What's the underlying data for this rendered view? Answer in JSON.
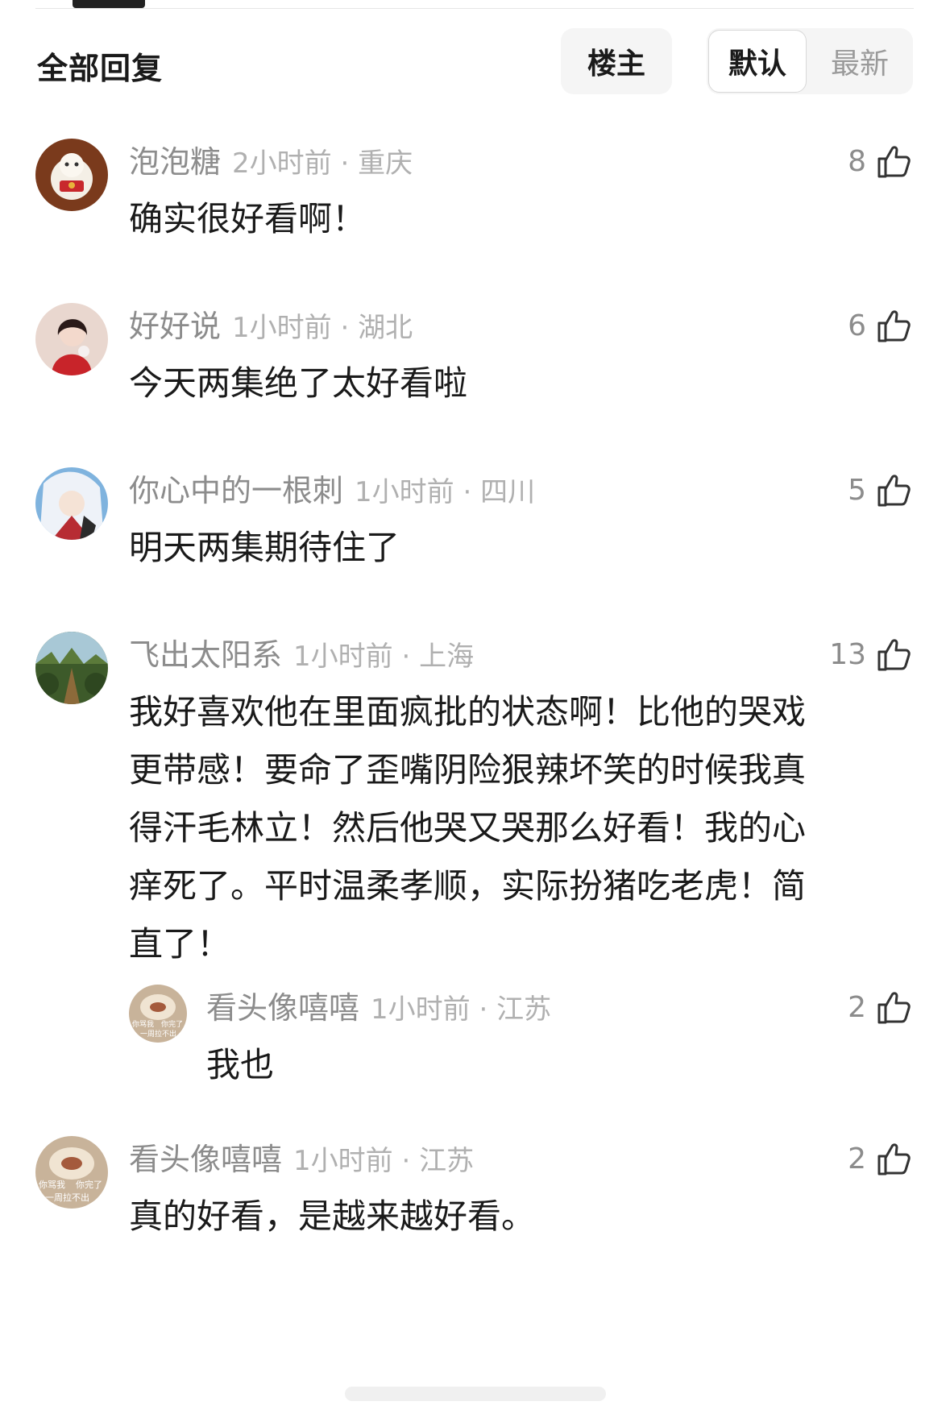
{
  "header": {
    "title": "全部回复",
    "filter_op": "楼主",
    "sort_default": "默认",
    "sort_latest": "最新"
  },
  "comments": [
    {
      "name": "泡泡糖",
      "time": "2小时前",
      "location": "重庆",
      "likes": "8",
      "text": "确实很好看啊！"
    },
    {
      "name": "好好说",
      "time": "1小时前",
      "location": "湖北",
      "likes": "6",
      "text": "今天两集绝了太好看啦"
    },
    {
      "name": "你心中的一根刺",
      "time": "1小时前",
      "location": "四川",
      "likes": "5",
      "text": "明天两集期待住了"
    },
    {
      "name": "飞出太阳系",
      "time": "1小时前",
      "location": "上海",
      "likes": "13",
      "text_lines": [
        "我好喜欢他在里面疯批的状态啊！比他的哭戏",
        "更带感！要命了歪嘴阴险狠辣坏笑的时候我真",
        "得汗毛林立！然后他哭又哭那么好看！我的心",
        "痒死了。平时温柔孝顺，实际扮猪吃老虎！简",
        "直了！"
      ]
    },
    {
      "name": "看头像嘻嘻",
      "time": "1小时前",
      "location": "江苏",
      "likes": "2",
      "text": "我也",
      "avatar_caption_1": "你骂我",
      "avatar_caption_2": "你完了",
      "avatar_caption_3": "一周拉不出"
    },
    {
      "name": "看头像嘻嘻",
      "time": "1小时前",
      "location": "江苏",
      "likes": "2",
      "text": "真的好看，是越来越好看。",
      "avatar_caption_1": "你骂我",
      "avatar_caption_2": "你完了",
      "avatar_caption_3": "一周拉不出"
    }
  ],
  "separator": "·",
  "colors": {
    "meta": "#8c8c8c",
    "text": "#1a1a1a",
    "tab_bg": "#f5f5f5"
  }
}
